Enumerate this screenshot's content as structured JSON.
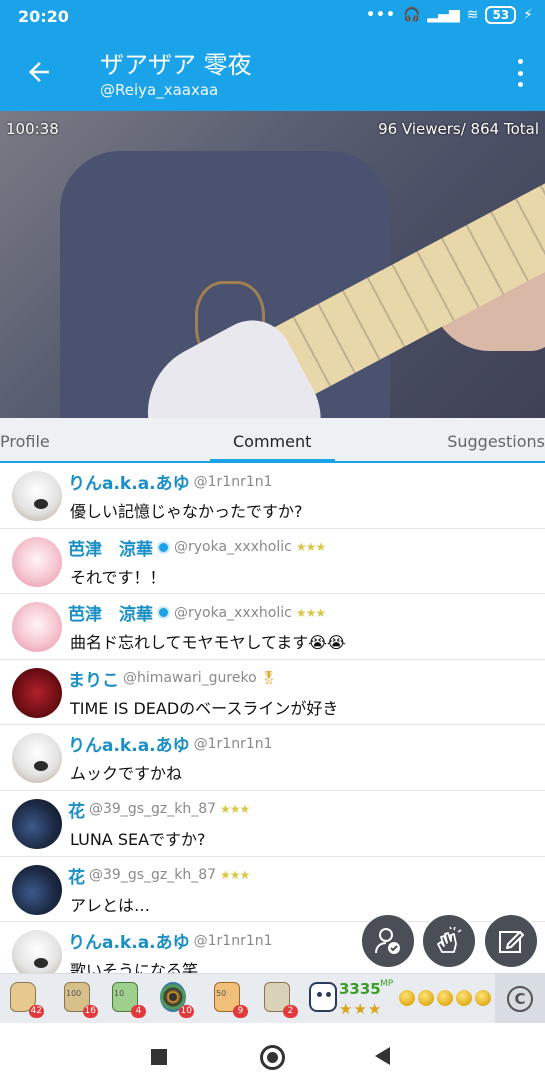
{
  "status_bar": {
    "time": "20:20",
    "battery": "53",
    "icons": [
      "more-dots-icon",
      "headphones-icon",
      "signal-icon",
      "wifi-icon",
      "battery-icon",
      "charging-icon"
    ]
  },
  "header": {
    "title": "ザアザア 零夜",
    "subtitle": "@Reiya_xaaxaa",
    "back_icon": "arrow-left-icon",
    "menu_icon": "more-vertical-icon"
  },
  "video": {
    "elapsed": "100:38",
    "viewers": "96 Viewers/ 864 Total"
  },
  "tabs": [
    {
      "label": "Profile",
      "active": false
    },
    {
      "label": "Comment",
      "active": true
    },
    {
      "label": "Suggestions",
      "active": false
    }
  ],
  "comments": [
    {
      "name": "りんa.k.a.あゆ",
      "handle": "@1r1nr1n1",
      "text": "優しい記憶じゃなかったですか?",
      "verified": false,
      "stars": "",
      "avatar": "white-cat"
    },
    {
      "name": "芭津　涼華",
      "handle": "@ryoka_xxxholic",
      "text": "それです！！",
      "verified": true,
      "stars": "★★★",
      "avatar": "pink"
    },
    {
      "name": "芭津　涼華",
      "handle": "@ryoka_xxxholic",
      "text": "曲名ド忘れしてモヤモヤしてます😭😭",
      "verified": true,
      "stars": "★★★",
      "avatar": "pink"
    },
    {
      "name": "まりこ",
      "handle": "@himawari_gureko",
      "text": "TIME IS DEADのベースラインが好き",
      "verified": false,
      "stars": "",
      "badge": "🎖",
      "avatar": "red"
    },
    {
      "name": "りんa.k.a.あゆ",
      "handle": "@1r1nr1n1",
      "text": "ムックですかね",
      "verified": false,
      "stars": "",
      "avatar": "white-cat"
    },
    {
      "name": "花",
      "handle": "@39_gs_gz_kh_87",
      "text": "LUNA SEAですか?",
      "verified": false,
      "stars": "★★★",
      "avatar": "dark"
    },
    {
      "name": "花",
      "handle": "@39_gs_gz_kh_87",
      "text": "アレとは…",
      "verified": false,
      "stars": "★★★",
      "avatar": "dark"
    },
    {
      "name": "りんa.k.a.あゆ",
      "handle": "@1r1nr1n1",
      "text": "歌いそうになる笑",
      "verified": false,
      "stars": "",
      "avatar": "white-cat"
    }
  ],
  "fabs": [
    {
      "name": "follow-button",
      "icon": "user-check-icon"
    },
    {
      "name": "clap-button",
      "icon": "clap-icon"
    },
    {
      "name": "write-comment-button",
      "icon": "pencil-box-icon"
    }
  ],
  "gifts": [
    {
      "icon": "hand-gift-icon",
      "label": "",
      "count": "42"
    },
    {
      "icon": "tea-100-icon",
      "label": "100",
      "count": "16"
    },
    {
      "icon": "tea-10-icon",
      "label": "10",
      "count": "4"
    },
    {
      "icon": "wheel-gift-icon",
      "label": "",
      "count": "10"
    },
    {
      "icon": "tea-50-icon",
      "label": "50",
      "count": "9"
    },
    {
      "icon": "tea-icon",
      "label": "",
      "count": "2"
    }
  ],
  "mp": {
    "value": "3335",
    "unit": "MP",
    "stars": "★★★",
    "coins": 5
  },
  "c_button": "C",
  "nav": {
    "recent_icon": "square-icon",
    "home_icon": "circle-icon",
    "back_icon": "triangle-back-icon"
  }
}
